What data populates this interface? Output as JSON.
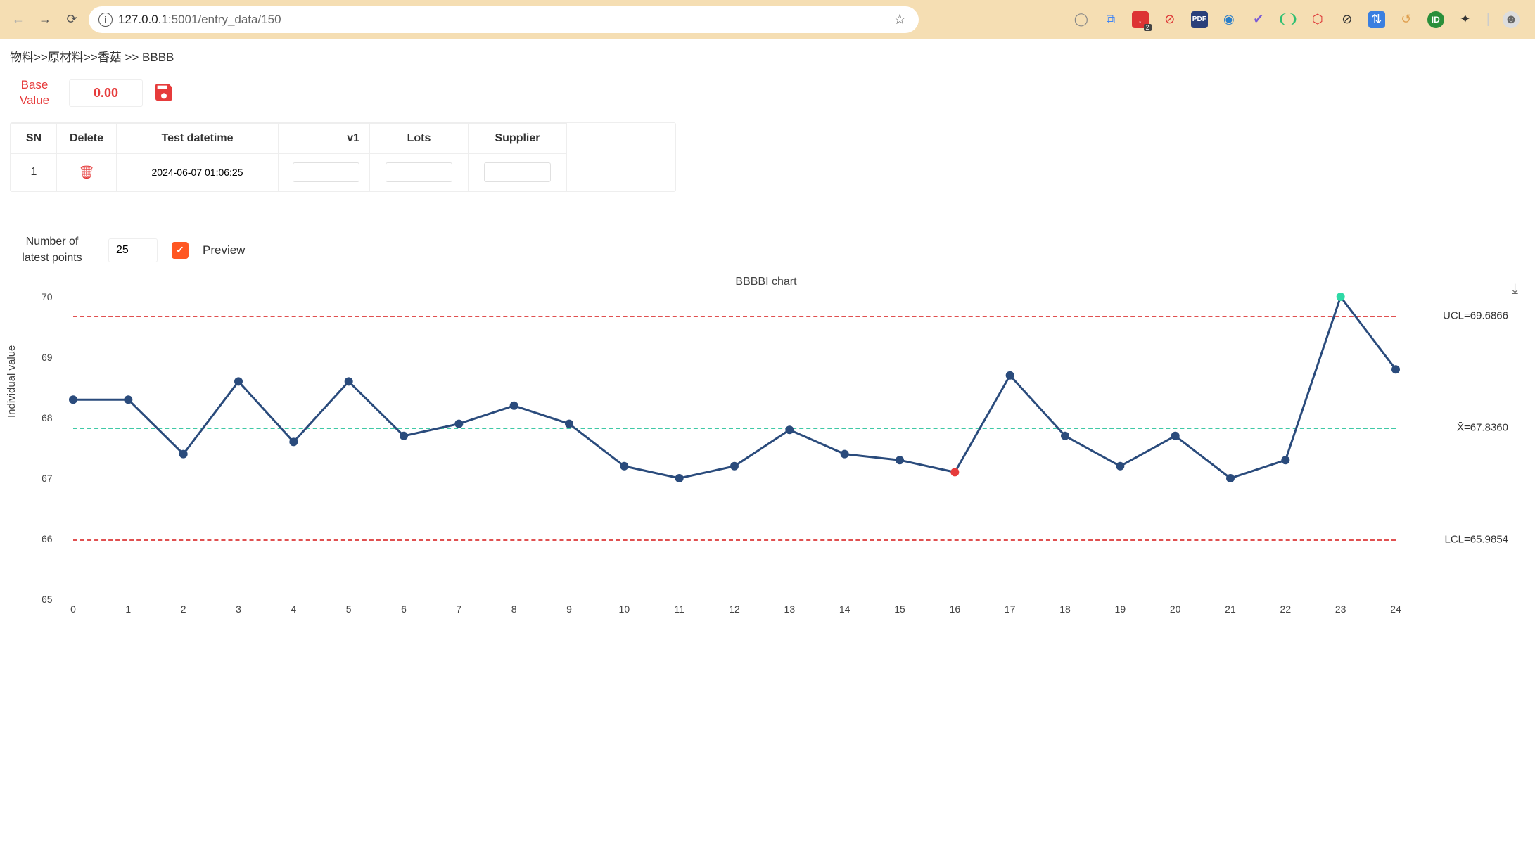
{
  "browser": {
    "url_gray": "127.0.0.1",
    "url_rest": ":5001/entry_data/150"
  },
  "breadcrumb": "物料>>原材料>>香菇 >> BBBB",
  "base_value": {
    "label1": "Base",
    "label2": "Value",
    "value": "0.00"
  },
  "table": {
    "headers": {
      "sn": "SN",
      "del": "Delete",
      "dt": "Test datetime",
      "v1": "v1",
      "lots": "Lots",
      "supplier": "Supplier"
    },
    "rows": [
      {
        "sn": "1",
        "datetime": "2024-06-07 01:06:25",
        "v1": "",
        "lots": "",
        "supplier": ""
      }
    ]
  },
  "preview": {
    "np_label1": "Number of",
    "np_label2": "latest points",
    "np_value": "25",
    "label": "Preview",
    "checked": true
  },
  "chart_data": {
    "type": "line",
    "title": "BBBBI chart",
    "ylabel": "Individual value",
    "x": [
      0,
      1,
      2,
      3,
      4,
      5,
      6,
      7,
      8,
      9,
      10,
      11,
      12,
      13,
      14,
      15,
      16,
      17,
      18,
      19,
      20,
      21,
      22,
      23,
      24
    ],
    "values": [
      68.3,
      68.3,
      67.4,
      68.6,
      67.6,
      68.6,
      67.7,
      67.9,
      68.2,
      67.9,
      67.2,
      67.0,
      67.2,
      67.8,
      67.4,
      67.3,
      67.1,
      68.7,
      67.7,
      67.2,
      67.7,
      67.0,
      67.3,
      70.0,
      68.8
    ],
    "outlier_indices_low": [
      16
    ],
    "outlier_indices_high": [
      23
    ],
    "ucl": 69.6866,
    "lcl": 65.9854,
    "mean": 67.836,
    "ylim": [
      65,
      70
    ],
    "yticks": [
      65,
      66,
      67,
      68,
      69,
      70
    ],
    "ucl_label": "UCL=69.6866",
    "mean_label": "X̄=67.8360",
    "lcl_label": "LCL=65.9854"
  }
}
